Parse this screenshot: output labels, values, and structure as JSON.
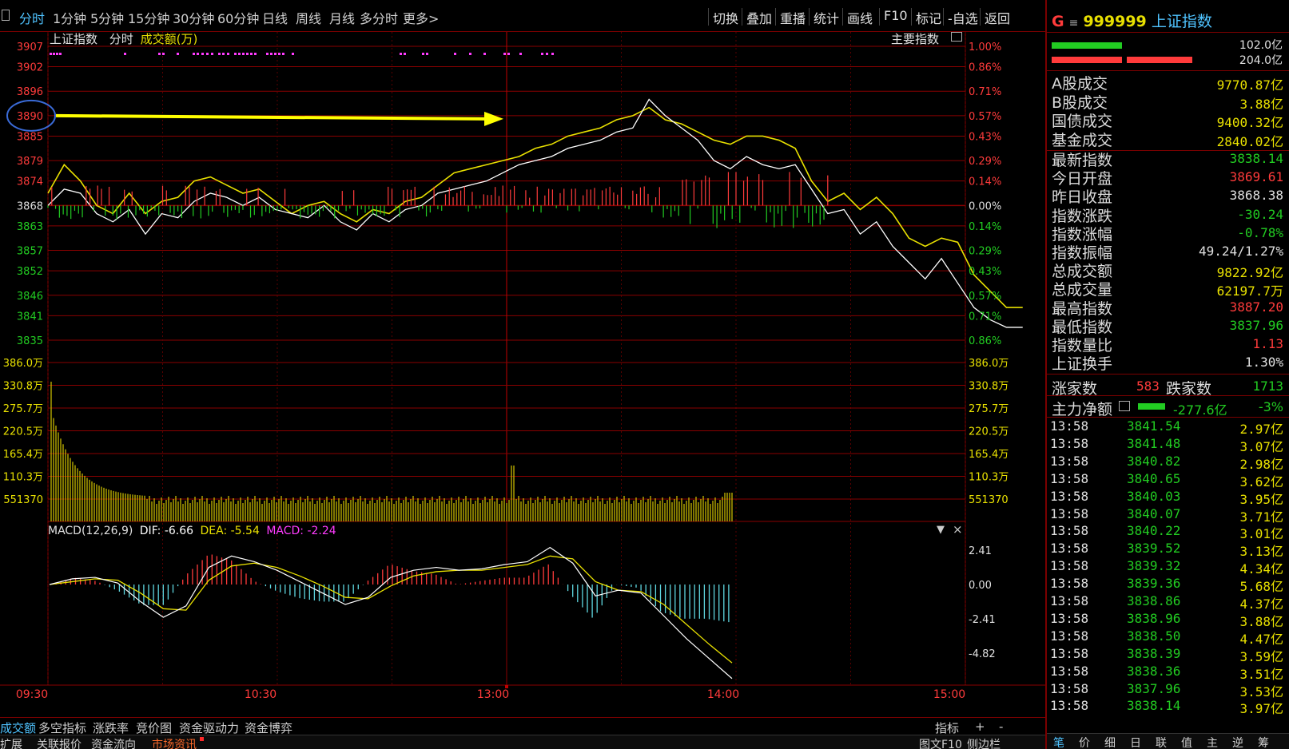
{
  "toolbar": {
    "periods": [
      "分时",
      "1分钟",
      "5分钟",
      "15分钟",
      "30分钟",
      "60分钟",
      "日线",
      "周线",
      "月线",
      "多分时",
      "更多>"
    ],
    "active_period": "分时",
    "tools": [
      "切换",
      "叠加",
      "重播",
      "统计",
      "画线",
      "F10",
      "标记",
      "-自选",
      "返回"
    ]
  },
  "chart_header": {
    "index_name": "上证指数",
    "mode": "分时",
    "volume_label": "成交额(万)",
    "main_index_label": "主要指数"
  },
  "macd_header": {
    "name": "MACD(12,26,9)",
    "dif": "DIF: -6.66",
    "dea": "DEA: -5.54",
    "macd": "MACD: -2.24"
  },
  "colors": {
    "up": "#ff3b3b",
    "down": "#22cc22",
    "price_line": "#ffffff",
    "avg_line": "#e8e000",
    "accent": "#4fc3ff",
    "grid": "#8a0000",
    "macd_pink": "#ff3bff",
    "macd_cyan": "#5fd7e0"
  },
  "chart_data": [
    {
      "type": "line",
      "title": "上证指数 分时",
      "x_ticks": [
        "09:30",
        "10:30",
        "13:00",
        "14:00",
        "15:00"
      ],
      "y_ticks_left": [
        3907,
        3902,
        3896,
        3890,
        3885,
        3879,
        3874,
        3868,
        3863,
        3857,
        3852,
        3846,
        3841,
        3835
      ],
      "y_ticks_right": [
        "1.00%",
        "0.86%",
        "0.71%",
        "0.57%",
        "0.43%",
        "0.29%",
        "0.14%",
        "0.00%",
        "0.14%",
        "0.29%",
        "0.43%",
        "0.57%",
        "0.71%",
        "0.86%"
      ],
      "ylim": [
        3835,
        3907
      ],
      "prev_close": 3868.38,
      "highlight_level": 3890,
      "series": [
        {
          "name": "指数",
          "x": [
            0,
            5,
            10,
            15,
            20,
            25,
            30,
            35,
            40,
            45,
            50,
            55,
            60,
            65,
            70,
            75,
            80,
            85,
            90,
            95,
            100,
            105,
            110,
            115,
            120,
            125,
            130,
            135,
            140,
            145,
            150,
            155,
            160,
            165,
            170,
            175,
            180,
            185,
            190,
            195,
            200,
            205,
            210,
            215,
            220,
            225,
            230,
            235,
            240,
            245,
            250,
            255,
            260,
            265,
            270,
            275,
            280,
            285,
            290,
            295,
            300
          ],
          "values": [
            3868,
            3872,
            3871,
            3866,
            3864,
            3867,
            3861,
            3866,
            3865,
            3869,
            3871,
            3870,
            3868,
            3870,
            3867,
            3866,
            3865,
            3868,
            3864,
            3862,
            3866,
            3864,
            3867,
            3868,
            3871,
            3872,
            3873,
            3874,
            3876,
            3878,
            3879,
            3880,
            3882,
            3883,
            3884,
            3886,
            3887,
            3894,
            3890,
            3887,
            3884,
            3879,
            3877,
            3880,
            3878,
            3877,
            3878,
            3872,
            3866,
            3867,
            3861,
            3864,
            3858,
            3854,
            3850,
            3855,
            3849,
            3843,
            3840,
            3838.14,
            3838.14
          ]
        },
        {
          "name": "均线",
          "x": [
            0,
            5,
            10,
            15,
            20,
            25,
            30,
            35,
            40,
            45,
            50,
            55,
            60,
            65,
            70,
            75,
            80,
            85,
            90,
            95,
            100,
            105,
            110,
            115,
            120,
            125,
            130,
            135,
            140,
            145,
            150,
            155,
            160,
            165,
            170,
            175,
            180,
            185,
            190,
            195,
            200,
            205,
            210,
            215,
            220,
            225,
            230,
            235,
            240,
            245,
            250,
            255,
            260,
            265,
            270,
            275,
            280,
            285,
            290,
            295,
            300
          ],
          "values": [
            3871,
            3878,
            3874,
            3868,
            3866,
            3871,
            3866,
            3869,
            3870,
            3874,
            3875,
            3873,
            3871,
            3872,
            3869,
            3866,
            3868,
            3869,
            3866,
            3864,
            3867,
            3866,
            3869,
            3870,
            3873,
            3876,
            3877,
            3878,
            3879,
            3880,
            3882,
            3883,
            3885,
            3886,
            3887,
            3889,
            3890,
            3892,
            3889,
            3888,
            3886,
            3884,
            3883,
            3885,
            3885,
            3884,
            3882,
            3874,
            3869,
            3871,
            3867,
            3870,
            3866,
            3860,
            3858,
            3860,
            3859,
            3851,
            3847,
            3843,
            3843
          ]
        }
      ]
    },
    {
      "type": "bar",
      "title": "成交额(万)",
      "y_ticks": [
        "386.0万",
        "330.8万",
        "275.7万",
        "220.5万",
        "165.4万",
        "110.3万",
        "551370"
      ],
      "ylim": [
        0,
        4412000
      ],
      "note": "volume bars decay from ~3.86M at open, spike near 13:00"
    },
    {
      "type": "line",
      "title": "MACD(12,26,9)",
      "y_ticks": [
        "2.41",
        "0.00",
        "-2.41",
        "-4.82"
      ],
      "ylim": [
        -6.8,
        3.5
      ],
      "series": [
        {
          "name": "DIF",
          "values": [
            0.0,
            0.4,
            0.5,
            0.1,
            -1.2,
            -2.3,
            -1.5,
            1.2,
            2.0,
            1.6,
            1.0,
            0.2,
            -0.6,
            -1.4,
            -0.9,
            0.5,
            1.0,
            1.2,
            1.0,
            1.1,
            1.4,
            1.6,
            2.6,
            1.5,
            -0.8,
            -0.4,
            -0.6,
            -2.2,
            -3.8,
            -5.2,
            -6.6
          ]
        },
        {
          "name": "DEA",
          "values": [
            0.0,
            0.2,
            0.4,
            0.3,
            -0.6,
            -1.7,
            -1.8,
            0.3,
            1.3,
            1.5,
            1.2,
            0.6,
            -0.1,
            -0.9,
            -1.0,
            -0.1,
            0.6,
            0.9,
            1.0,
            1.0,
            1.2,
            1.4,
            2.0,
            1.8,
            0.2,
            -0.4,
            -0.5,
            -1.4,
            -2.8,
            -4.2,
            -5.5
          ]
        }
      ]
    }
  ],
  "right_panel": {
    "code_prefix": "G",
    "code": "999999",
    "name": "上证指数",
    "bars": [
      "102.0亿",
      "204.0亿"
    ],
    "trade_rows": [
      {
        "label": "A股成交",
        "value": "9770.87亿"
      },
      {
        "label": "B股成交",
        "value": "3.88亿"
      },
      {
        "label": "国债成交",
        "value": "9400.32亿"
      },
      {
        "label": "基金成交",
        "value": "2840.02亿"
      }
    ],
    "stat_rows": [
      {
        "label": "最新指数",
        "value": "3838.14",
        "color": "#22cc22"
      },
      {
        "label": "今日开盘",
        "value": "3869.61",
        "color": "#ff3b3b"
      },
      {
        "label": "昨日收盘",
        "value": "3868.38",
        "color": "#e0e0e0"
      },
      {
        "label": "指数涨跌",
        "value": "-30.24",
        "color": "#22cc22"
      },
      {
        "label": "指数涨幅",
        "value": "-0.78%",
        "color": "#22cc22"
      },
      {
        "label": "指数振幅",
        "value": "49.24/1.27%",
        "color": "#e0e0e0"
      },
      {
        "label": "总成交额",
        "value": "9822.92亿",
        "color": "#e8e000"
      },
      {
        "label": "总成交量",
        "value": "62197.7万",
        "color": "#e8e000"
      },
      {
        "label": "最高指数",
        "value": "3887.20",
        "color": "#ff3b3b"
      },
      {
        "label": "最低指数",
        "value": "3837.96",
        "color": "#22cc22"
      },
      {
        "label": "指数量比",
        "value": "1.13",
        "color": "#ff3b3b"
      },
      {
        "label": "上证换手",
        "value": "1.30%",
        "color": "#e0e0e0"
      }
    ],
    "advance": {
      "up_label": "涨家数",
      "up_value": "583",
      "down_label": "跌家数",
      "down_value": "1713"
    },
    "main_flow": {
      "label": "主力净额",
      "value": "-277.6亿",
      "pct": "-3%"
    },
    "ticks": [
      {
        "time": "13:58",
        "price": "3841.54",
        "amount": "2.97亿"
      },
      {
        "time": "13:58",
        "price": "3841.48",
        "amount": "3.07亿"
      },
      {
        "time": "13:58",
        "price": "3840.82",
        "amount": "2.98亿"
      },
      {
        "time": "13:58",
        "price": "3840.65",
        "amount": "3.62亿"
      },
      {
        "time": "13:58",
        "price": "3840.03",
        "amount": "3.95亿"
      },
      {
        "time": "13:58",
        "price": "3840.07",
        "amount": "3.71亿"
      },
      {
        "time": "13:58",
        "price": "3840.22",
        "amount": "3.01亿"
      },
      {
        "time": "13:58",
        "price": "3839.52",
        "amount": "3.13亿"
      },
      {
        "time": "13:58",
        "price": "3839.32",
        "amount": "4.34亿"
      },
      {
        "time": "13:58",
        "price": "3839.36",
        "amount": "5.68亿"
      },
      {
        "time": "13:58",
        "price": "3838.86",
        "amount": "4.37亿"
      },
      {
        "time": "13:58",
        "price": "3838.96",
        "amount": "3.88亿"
      },
      {
        "time": "13:58",
        "price": "3838.50",
        "amount": "4.47亿"
      },
      {
        "time": "13:58",
        "price": "3838.39",
        "amount": "3.59亿"
      },
      {
        "time": "13:58",
        "price": "3838.36",
        "amount": "3.51亿"
      },
      {
        "time": "13:58",
        "price": "3837.96",
        "amount": "3.53亿"
      },
      {
        "time": "13:58",
        "price": "3838.14",
        "amount": "3.97亿"
      }
    ],
    "bottom_tabs": [
      "笔",
      "价",
      "细",
      "日",
      "联",
      "值",
      "主",
      "逆",
      "筹"
    ]
  },
  "bottom_tabs_1": [
    "成交额",
    "多空指标",
    "涨跌率",
    "竞价图",
    "资金驱动力",
    "资金博弈"
  ],
  "bottom_tabs_1_right": [
    "指标",
    "+",
    "-"
  ],
  "bottom_tabs_2": [
    "扩展",
    "关联报价",
    "资金流向",
    "市场资讯"
  ],
  "bottom_tabs_2_right": [
    "图文F10",
    "侧边栏"
  ]
}
